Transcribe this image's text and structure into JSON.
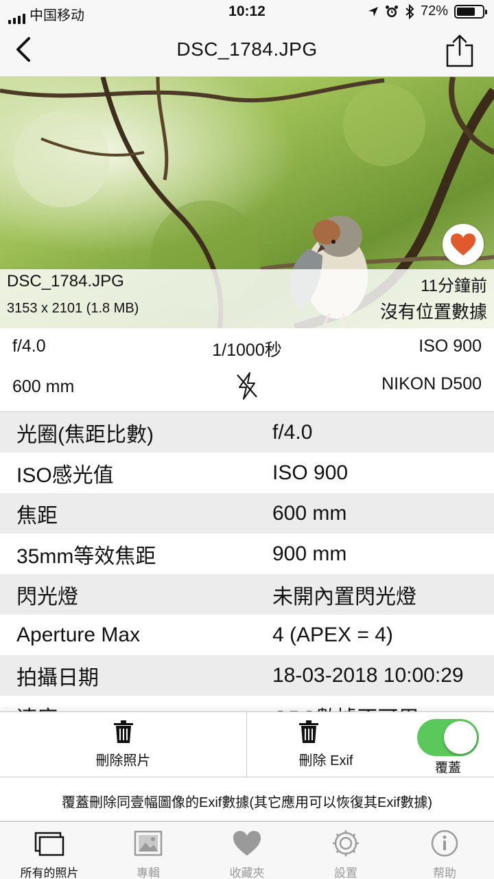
{
  "status_bar": {
    "carrier": "中国移动",
    "time": "10:12",
    "battery": "72%",
    "battery_level": 0.72
  },
  "nav": {
    "title": "DSC_1784.JPG",
    "back_icon": "chevron-left-icon",
    "share_icon": "share-icon"
  },
  "photo": {
    "filename": "DSC_1784.JPG",
    "dimensions": "3153 x 2101 (1.8 MB)",
    "time_ago": "11分鐘前",
    "location": "沒有位置數據",
    "favorite_icon": "heart-icon",
    "favorite_color": "#e05a2b"
  },
  "quick_info": {
    "aperture": "f/4.0",
    "shutter": "1/1000秒",
    "iso": "ISO 900",
    "focal_length": "600 mm",
    "flash_icon": "flash-off-icon",
    "camera": "NIKON D500"
  },
  "exif_rows": [
    {
      "key": "光圈(焦距比數)",
      "value": "f/4.0"
    },
    {
      "key": "ISO感光值",
      "value": "ISO 900"
    },
    {
      "key": "焦距",
      "value": "600 mm"
    },
    {
      "key": "35mm等效焦距",
      "value": "900 mm"
    },
    {
      "key": "閃光燈",
      "value": "未開內置閃光燈"
    },
    {
      "key": "Aperture Max",
      "value": "4 (APEX = 4)"
    },
    {
      "key": "拍攝日期",
      "value": "18-03-2018 10:00:29"
    },
    {
      "key": "速度",
      "value": "GPS數據不可用"
    }
  ],
  "actions": {
    "delete_photo": "刪除照片",
    "delete_exif": "刪除 Exif",
    "overwrite": "覆蓋",
    "overwrite_on": true,
    "toggle_color": "#5ac85a"
  },
  "note": "覆蓋刪除同壹幅圖像的Exif數據(其它應用可以恢復其Exif數據)",
  "tabs": [
    {
      "label": "所有的照片",
      "icon": "photos-icon",
      "active": true
    },
    {
      "label": "專輯",
      "icon": "album-icon",
      "active": false
    },
    {
      "label": "收藏夾",
      "icon": "heart-icon",
      "active": false
    },
    {
      "label": "設置",
      "icon": "gear-icon",
      "active": false
    },
    {
      "label": "帮助",
      "icon": "info-icon",
      "active": false
    }
  ]
}
